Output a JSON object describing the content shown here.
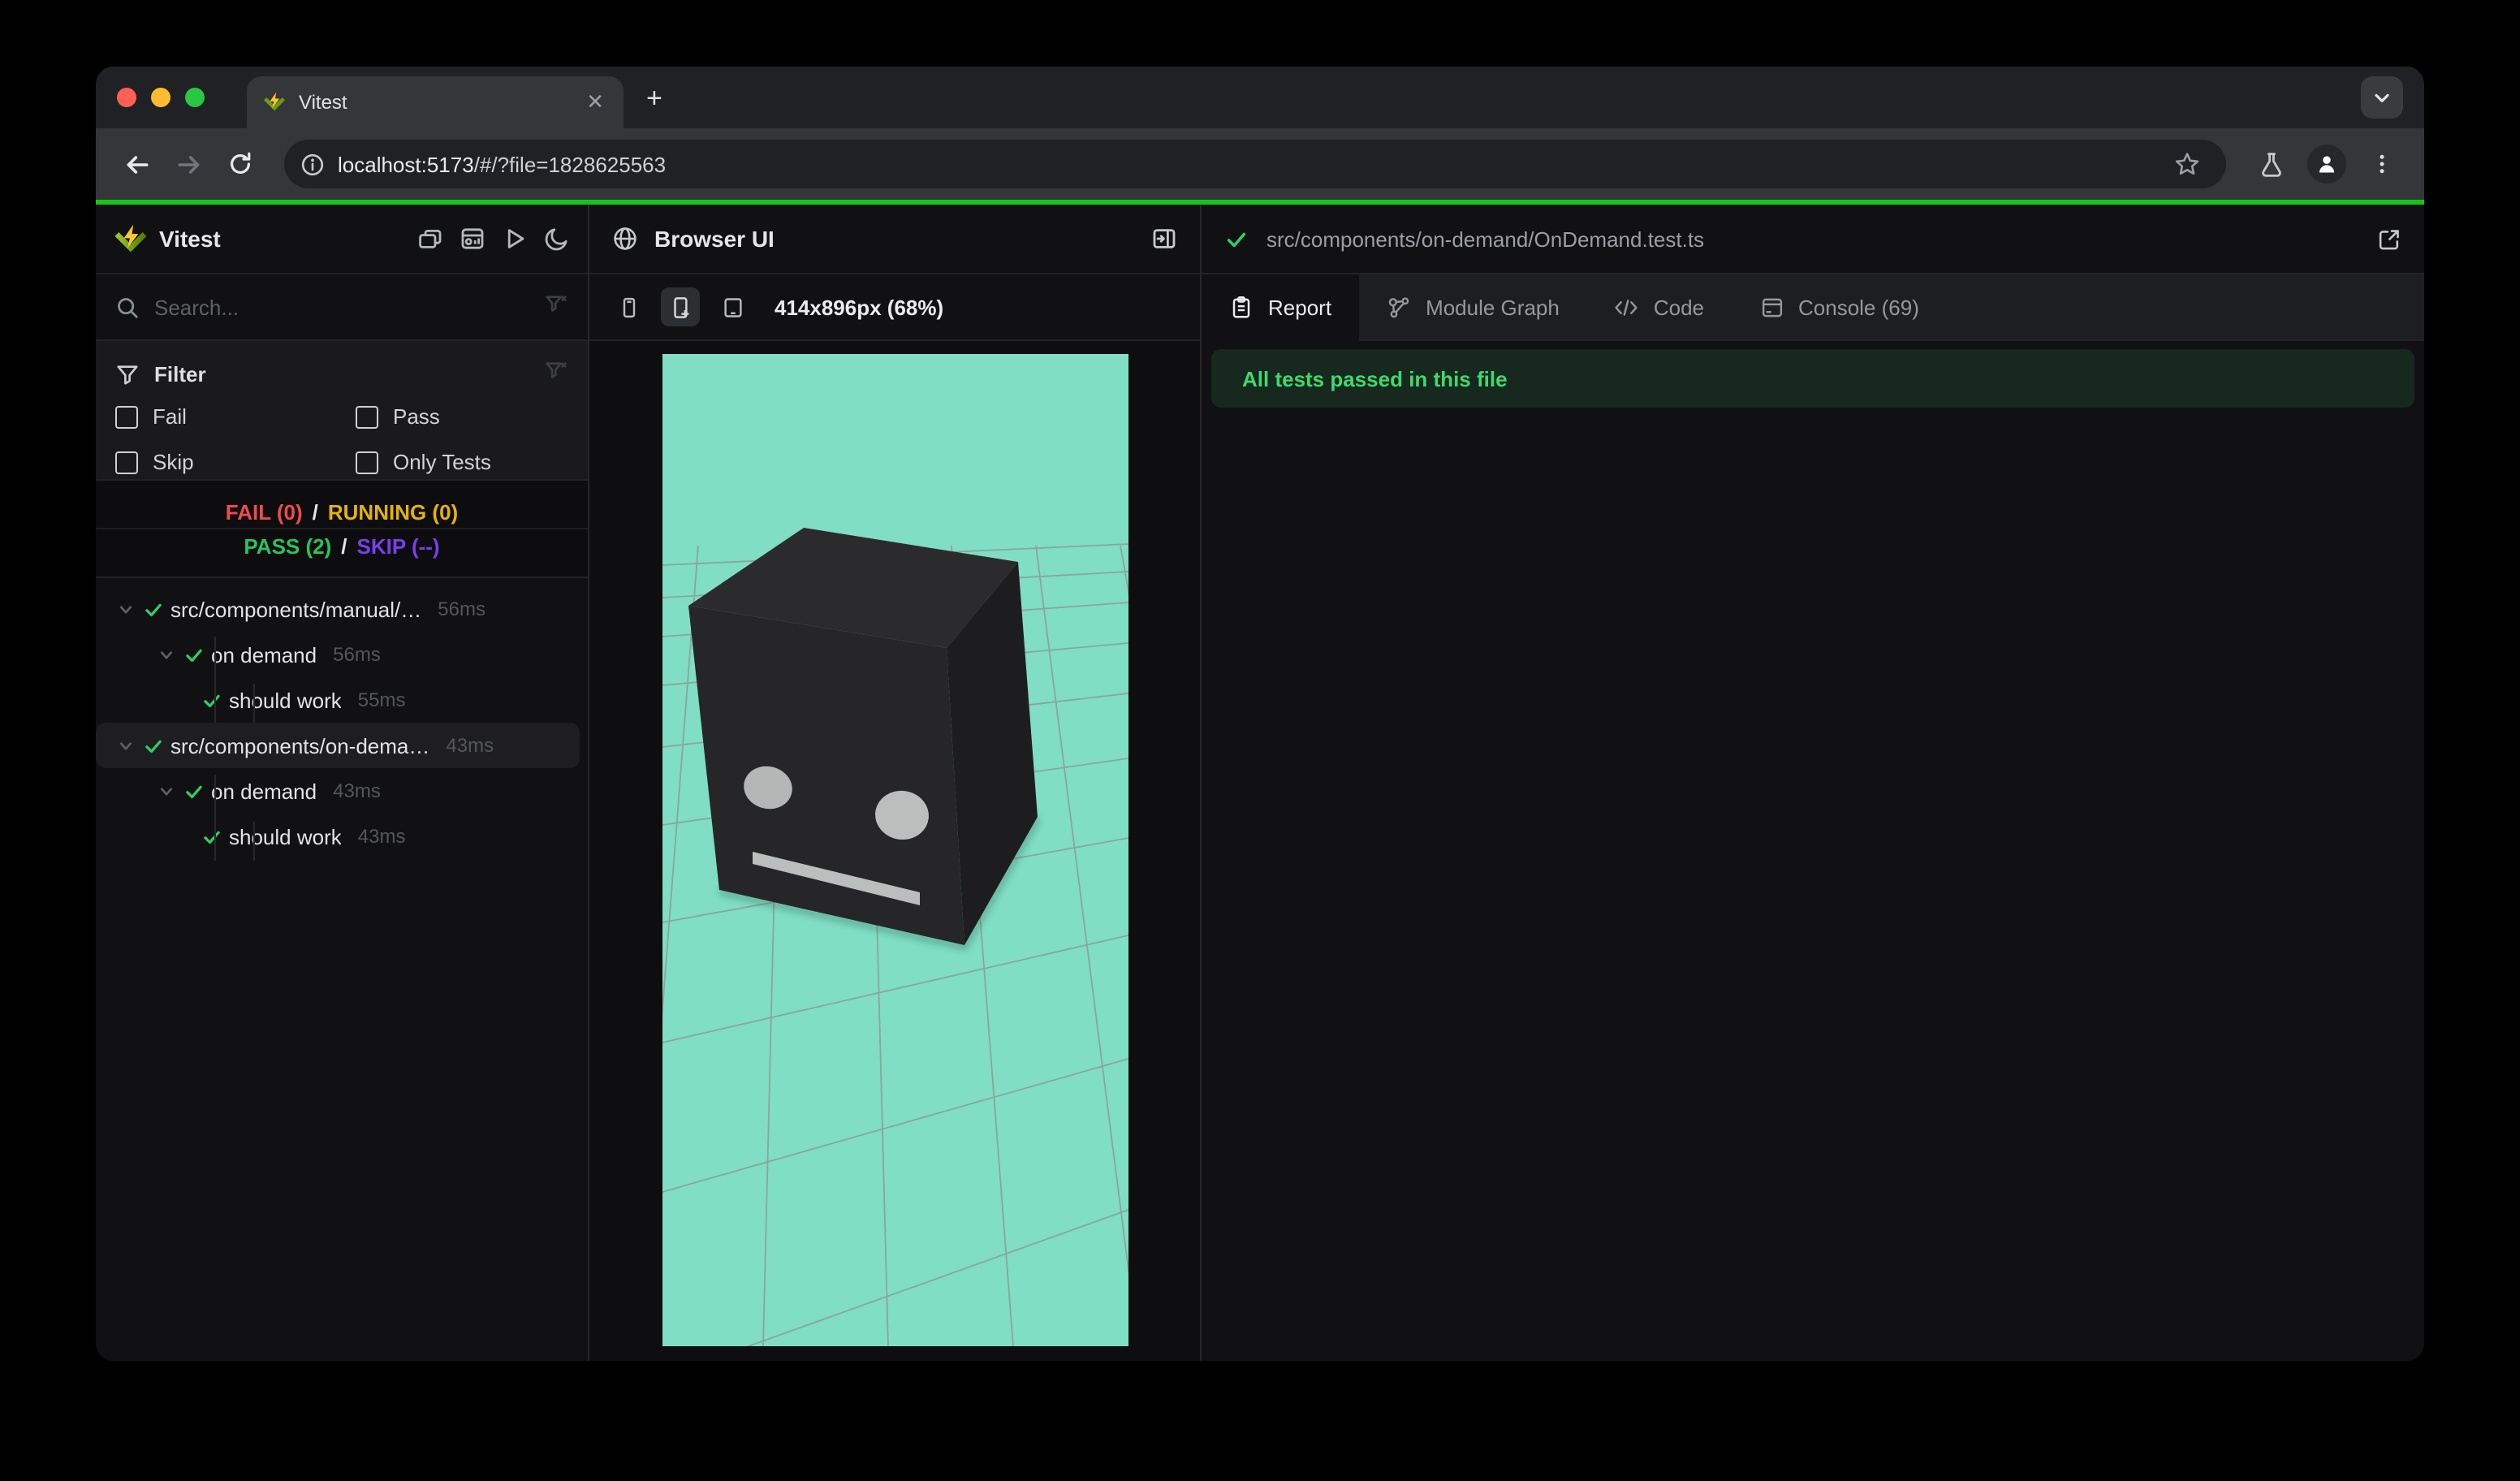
{
  "browser": {
    "tab_title": "Vitest",
    "close_glyph": "✕",
    "new_tab_glyph": "+",
    "url_host": "localhost:5173",
    "url_path": "/#/?file=1828625563"
  },
  "sidebar": {
    "app_title": "Vitest",
    "search_placeholder": "Search...",
    "filter": {
      "title": "Filter",
      "options": {
        "fail": "Fail",
        "pass": "Pass",
        "skip": "Skip",
        "only_tests": "Only Tests"
      }
    },
    "summary": {
      "fail": "FAIL (0)",
      "running": "RUNNING (0)",
      "pass": "PASS (2)",
      "skip": "SKIP (--)",
      "separator": "/"
    },
    "tree": [
      {
        "label": "src/components/manual/…",
        "duration": "56ms",
        "level": 0,
        "status": "pass"
      },
      {
        "label": "on demand",
        "duration": "56ms",
        "level": 1,
        "status": "pass"
      },
      {
        "label": "should work",
        "duration": "55ms",
        "level": 2,
        "status": "pass"
      },
      {
        "label": "src/components/on-dema…",
        "duration": "43ms",
        "level": 0,
        "status": "pass",
        "selected": true
      },
      {
        "label": "on demand",
        "duration": "43ms",
        "level": 1,
        "status": "pass"
      },
      {
        "label": "should work",
        "duration": "43ms",
        "level": 2,
        "status": "pass"
      }
    ]
  },
  "browser_panel": {
    "title": "Browser UI",
    "viewport_label": "414x896px (68%)"
  },
  "report_panel": {
    "file_path": "src/components/on-demand/OnDemand.test.ts",
    "tabs": {
      "report": "Report",
      "module_graph": "Module Graph",
      "code": "Code",
      "console": "Console (69)"
    },
    "banner": "All tests passed in this file"
  },
  "colors": {
    "progress_green": "#15c51b",
    "pass_green": "#27c45e",
    "fail_red": "#f04a4a",
    "running_yellow": "#e5b306",
    "skip_purple": "#7a3df0",
    "viewport_bg": "#7fdec3",
    "banner_bg": "#17281e",
    "banner_text": "#3fd96c",
    "logo_bolt": "#fcc72b",
    "logo_chevron": "#6f9a15"
  }
}
